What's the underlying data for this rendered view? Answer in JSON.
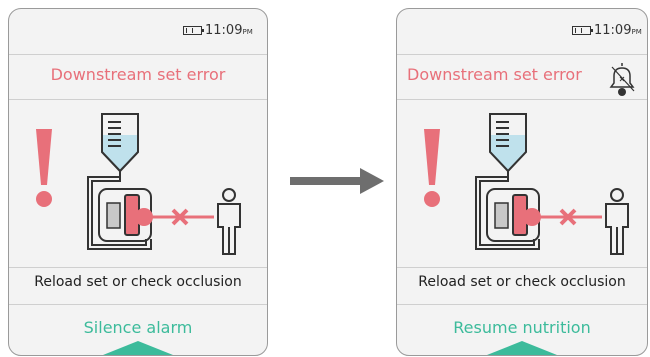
{
  "screens": [
    {
      "status": {
        "time": "11:09",
        "ampm": "PM"
      },
      "title": "Downstream set error",
      "message": "Reload set or check occlusion",
      "action": "Silence alarm",
      "bell_muted": false
    },
    {
      "status": {
        "time": "11:09",
        "ampm": "PM"
      },
      "title": "Downstream set error",
      "message": "Reload set or check occlusion",
      "action": "Resume nutrition",
      "bell_muted": true
    }
  ],
  "colors": {
    "alert": "#e8707a",
    "action": "#3cbb9b",
    "arrow": "#6e6e6e",
    "screen_bg": "#f3f3f3"
  },
  "icons": [
    "battery-icon",
    "exclamation-icon",
    "iv-bag-icon",
    "pump-icon",
    "occlusion-x-icon",
    "patient-icon",
    "muted-bell-icon",
    "transition-arrow-icon"
  ]
}
